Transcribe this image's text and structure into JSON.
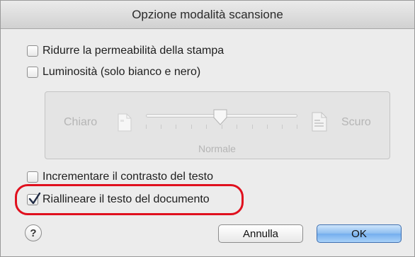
{
  "dialog": {
    "title": "Opzione modalità scansione",
    "options": [
      {
        "label": "Ridurre la permeabilità della stampa",
        "checked": false
      },
      {
        "label": "Luminosità (solo bianco e nero)",
        "checked": false
      },
      {
        "label": "Incrementare il contrasto del testo",
        "checked": false
      },
      {
        "label": "Riallineare il testo del documento",
        "checked": true
      }
    ],
    "brightness": {
      "left_label": "Chiaro",
      "right_label": "Scuro",
      "center_label": "Normale",
      "value_fraction": 0.5,
      "enabled": false
    },
    "buttons": {
      "help": "?",
      "cancel": "Annulla",
      "ok": "OK"
    },
    "highlight_color": "#e0101e"
  }
}
